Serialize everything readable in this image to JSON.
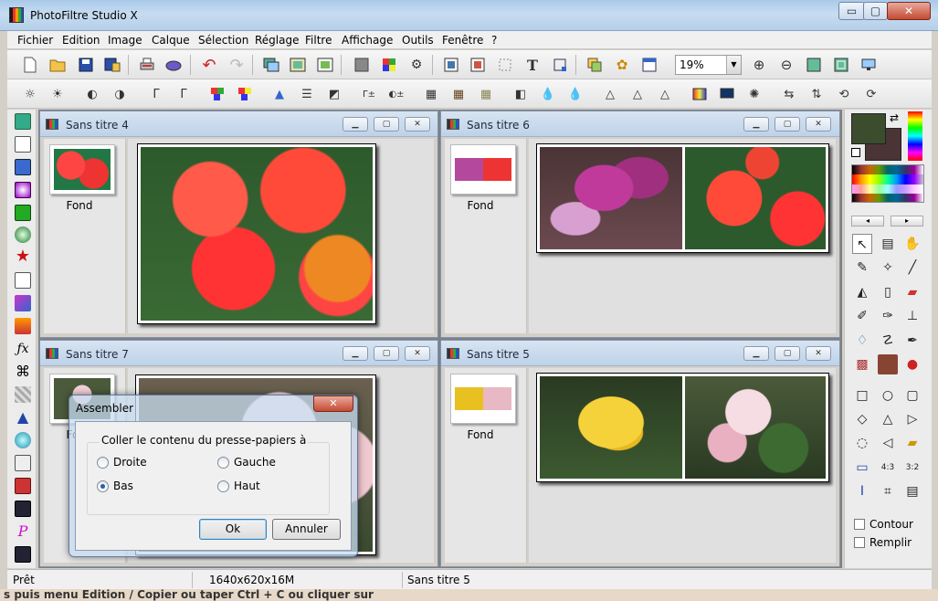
{
  "window": {
    "title": "PhotoFiltre Studio X",
    "minimize": "▭",
    "maximize": "▢",
    "close": "✕"
  },
  "menu": [
    "Fichier",
    "Edition",
    "Image",
    "Calque",
    "Sélection",
    "Réglage",
    "Filtre",
    "Affichage",
    "Outils",
    "Fenêtre",
    "?"
  ],
  "toolbar": {
    "zoom_value": "19%"
  },
  "documents": [
    {
      "title": "Sans titre 4",
      "layer": "Fond"
    },
    {
      "title": "Sans titre 6",
      "layer": "Fond"
    },
    {
      "title": "Sans titre 7",
      "layer": "Fond"
    },
    {
      "title": "Sans titre 5",
      "layer": "Fond"
    }
  ],
  "dialog": {
    "title": "Assembler",
    "group_label": "Coller le contenu du presse-papiers à",
    "options": [
      "Droite",
      "Gauche",
      "Bas",
      "Haut"
    ],
    "selected": "Bas",
    "ok": "Ok",
    "cancel": "Annuler"
  },
  "right_panel": {
    "contour": "Contour",
    "remplir": "Remplir"
  },
  "status": {
    "left": "Prêt",
    "size": "1640x620x16M",
    "doc": "Sans titre 5"
  },
  "background_text": "s puis menu Edition / Copier ou taper Ctrl + C ou cliquer sur",
  "colors": {
    "foreground": "#3c4d2e",
    "background": "#4a3436",
    "titlebar": "#bed2e8"
  }
}
